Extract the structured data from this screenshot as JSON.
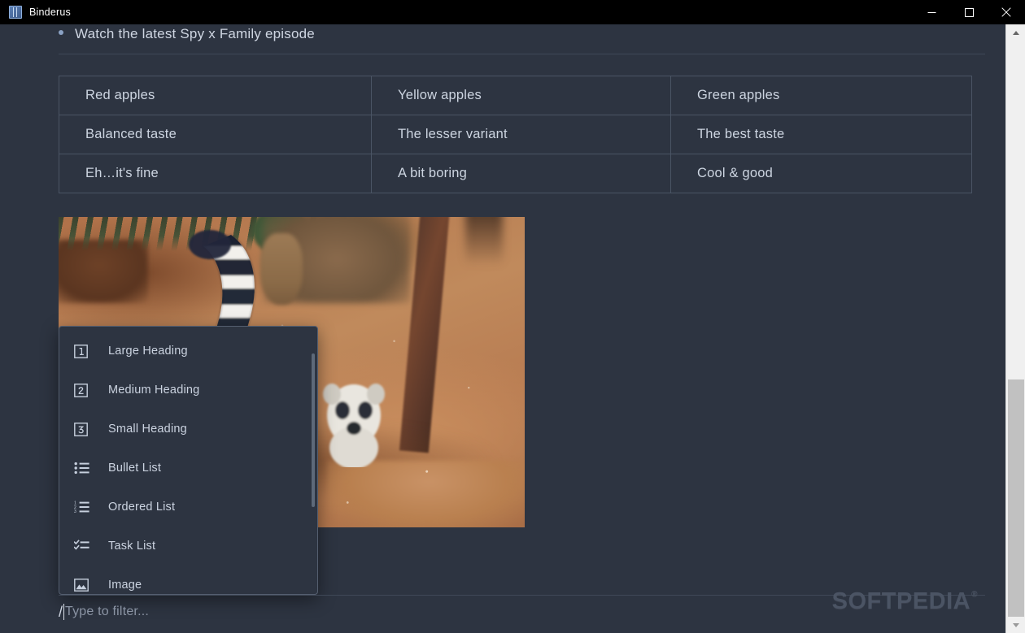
{
  "window": {
    "title": "Binderus",
    "icon": "book-icon",
    "controls": {
      "minimize": "Minimize",
      "maximize": "Maximize",
      "close": "Close"
    }
  },
  "document": {
    "bullet_item": "Watch the latest Spy x Family episode",
    "table": {
      "headers": [
        "Red apples",
        "Yellow apples",
        "Green apples"
      ],
      "rows": [
        [
          "Balanced taste",
          "The lesser variant",
          "The best taste"
        ],
        [
          "Eh…it's fine",
          "A bit boring",
          "Cool & good"
        ]
      ]
    },
    "image_alt": "ring-tailed lemur on red sand"
  },
  "slash_menu": {
    "items": [
      {
        "label": "Large Heading",
        "icon": "heading-1-icon"
      },
      {
        "label": "Medium Heading",
        "icon": "heading-2-icon"
      },
      {
        "label": "Small Heading",
        "icon": "heading-3-icon"
      },
      {
        "label": "Bullet List",
        "icon": "bullet-list-icon"
      },
      {
        "label": "Ordered List",
        "icon": "ordered-list-icon"
      },
      {
        "label": "Task List",
        "icon": "task-list-icon"
      },
      {
        "label": "Image",
        "icon": "image-icon"
      }
    ]
  },
  "filter_bar": {
    "trigger": "/",
    "placeholder": "Type to filter...",
    "value": ""
  },
  "watermark": {
    "text": "SOFTPEDIA",
    "registered": "®"
  },
  "colors": {
    "page_background": "#2d3441",
    "titlebar": "#000000",
    "text_primary": "#cdd5e1",
    "text_muted": "#8b94a4",
    "border": "#4a5464",
    "menu_border": "#555f70",
    "scrollbar_track": "#f0f0f0",
    "scrollbar_thumb": "#c1c1c1"
  }
}
